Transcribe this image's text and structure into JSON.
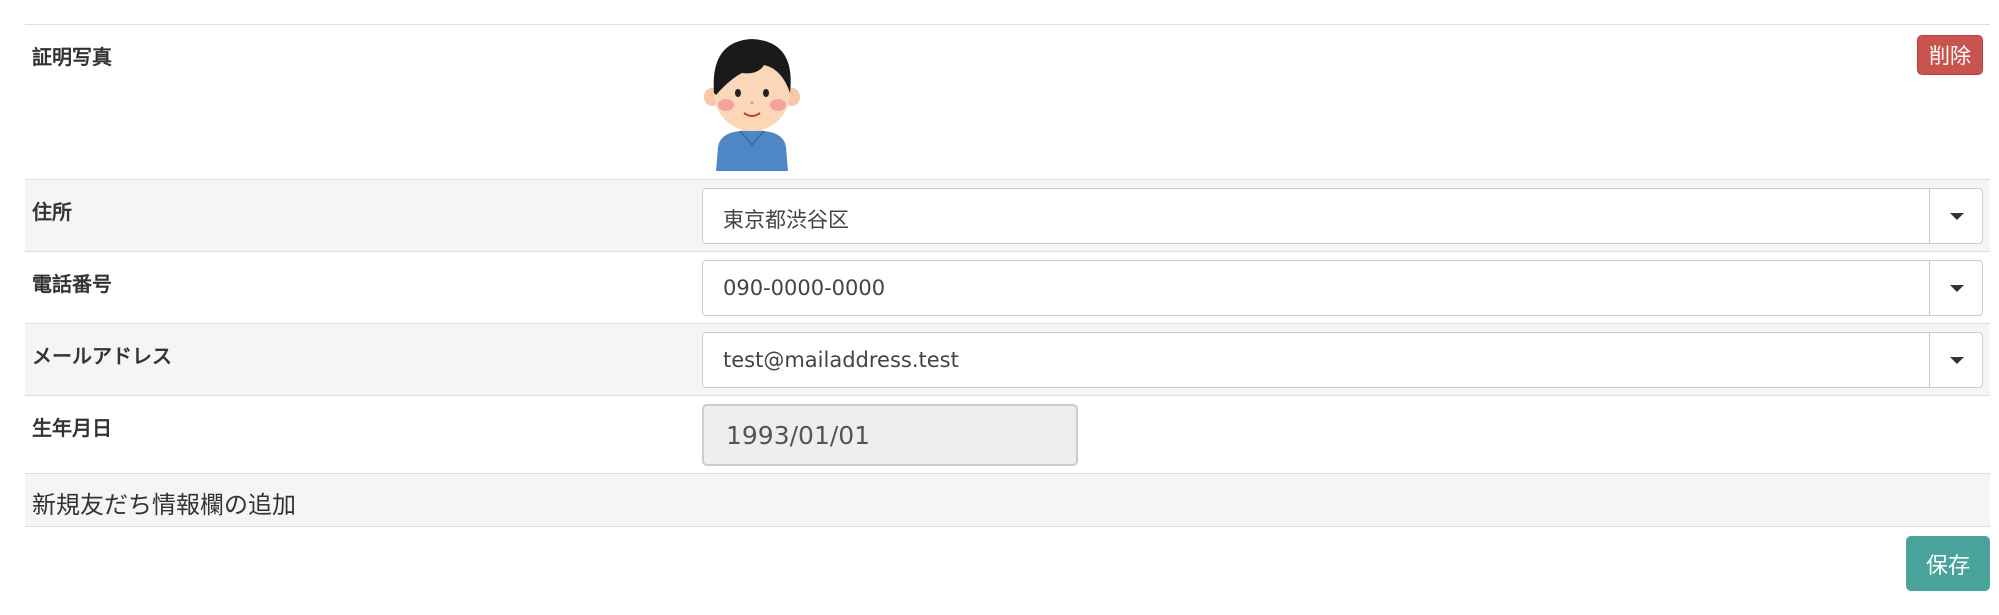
{
  "photo": {
    "label": "証明写真",
    "delete_label": "削除"
  },
  "address": {
    "label": "住所",
    "value": "東京都渋谷区"
  },
  "phone": {
    "label": "電話番号",
    "value": "090-0000-0000"
  },
  "email": {
    "label": "メールアドレス",
    "value": "test@mailaddress.test"
  },
  "birthday": {
    "label": "生年月日",
    "value": "1993/01/01"
  },
  "add_field_label": "新規友だち情報欄の追加",
  "save_label": "保存",
  "colors": {
    "delete": "#c9534f",
    "save": "#4aa39a",
    "row_shade": "#f5f5f5"
  },
  "icons": {
    "avatar": "person-avatar-illustration",
    "dropdown": "caret-down-icon"
  }
}
